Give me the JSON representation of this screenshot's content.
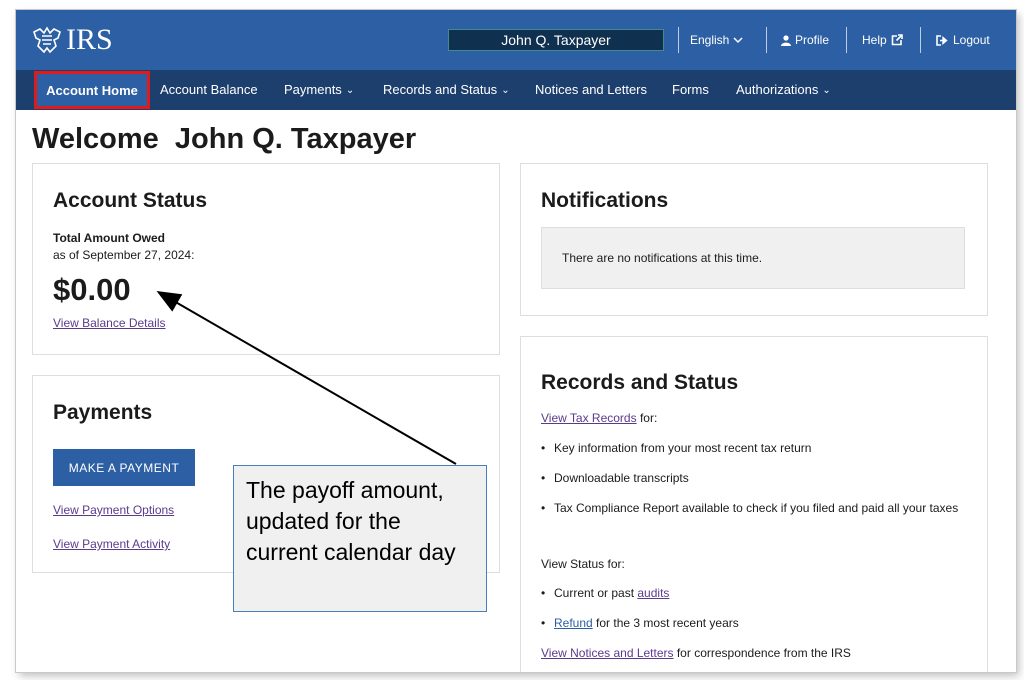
{
  "header": {
    "logo_text": "IRS",
    "user_name": "John Q. Taxpayer",
    "language": "English",
    "profile": "Profile",
    "help": "Help",
    "logout": "Logout"
  },
  "nav": {
    "items": [
      {
        "label": "Account Home",
        "active": true
      },
      {
        "label": "Account Balance"
      },
      {
        "label": "Payments",
        "dropdown": true
      },
      {
        "label": "Records and Status",
        "dropdown": true
      },
      {
        "label": "Notices and Letters"
      },
      {
        "label": "Forms"
      },
      {
        "label": "Authorizations",
        "dropdown": true
      }
    ]
  },
  "page": {
    "welcome": "Welcome  John Q. Taxpayer"
  },
  "account_status": {
    "title": "Account Status",
    "owed_label": "Total Amount Owed",
    "owed_date": "as of September 27, 2024:",
    "amount": "$0.00",
    "details_link": "View Balance Details"
  },
  "payments": {
    "title": "Payments",
    "make_payment": "MAKE A PAYMENT",
    "options_link": "View Payment Options",
    "activity_link": "View Payment Activity"
  },
  "notifications": {
    "title": "Notifications",
    "empty_text": "There are no notifications at this time."
  },
  "records": {
    "title": "Records and Status",
    "tax_records_link": "View Tax Records",
    "tax_records_suffix": " for:",
    "bullets": [
      "Key information from your most recent tax return",
      "Downloadable transcripts",
      "Tax Compliance Report available to check if you filed and paid all your taxes"
    ],
    "status_for": "View Status for:",
    "audits_prefix": "Current or past ",
    "audits_link": "audits",
    "refund_link": "Refund",
    "refund_suffix": " for the 3 most recent years",
    "notices_link": "View Notices and Letters",
    "notices_suffix": " for correspondence from the IRS"
  },
  "callout": {
    "text": "The payoff amount, updated for the current calendar day"
  },
  "colors": {
    "header_blue": "#2c5fa3",
    "nav_navy": "#1d3f6e",
    "highlight_red": "#e01b1b",
    "link_purple": "#5b3a8c"
  }
}
